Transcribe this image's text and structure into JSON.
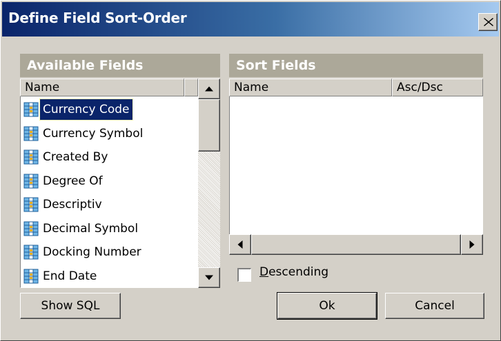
{
  "dialog": {
    "title": "Define Field Sort-Order",
    "close_symbol": "X"
  },
  "available": {
    "header": "Available Fields",
    "column_name": "Name",
    "items": [
      {
        "label": "Currency Code",
        "selected": true
      },
      {
        "label": "Currency Symbol"
      },
      {
        "label": "Created By"
      },
      {
        "label": "Degree Of"
      },
      {
        "label": "Descriptiv"
      },
      {
        "label": "Decimal Symbol"
      },
      {
        "label": "Docking Number"
      },
      {
        "label": "End Date"
      }
    ]
  },
  "sort": {
    "header": "Sort Fields",
    "column_name": "Name",
    "column_order": "Asc/Dsc",
    "descending_label": "Descending",
    "descending_checked": false
  },
  "buttons": {
    "show_sql": "Show SQL",
    "ok": "Ok",
    "cancel": "Cancel"
  },
  "icons": {
    "field": "field-icon",
    "close": "close-icon",
    "scroll_up": "arrow-up-icon",
    "scroll_down": "arrow-down-icon",
    "scroll_left": "arrow-left-icon",
    "scroll_right": "arrow-right-icon"
  },
  "colors": {
    "title_start": "#0a246a",
    "title_end": "#a6caf0",
    "selection": "#0a246a",
    "panel_header": "#aca899",
    "face": "#d4d0c8"
  }
}
